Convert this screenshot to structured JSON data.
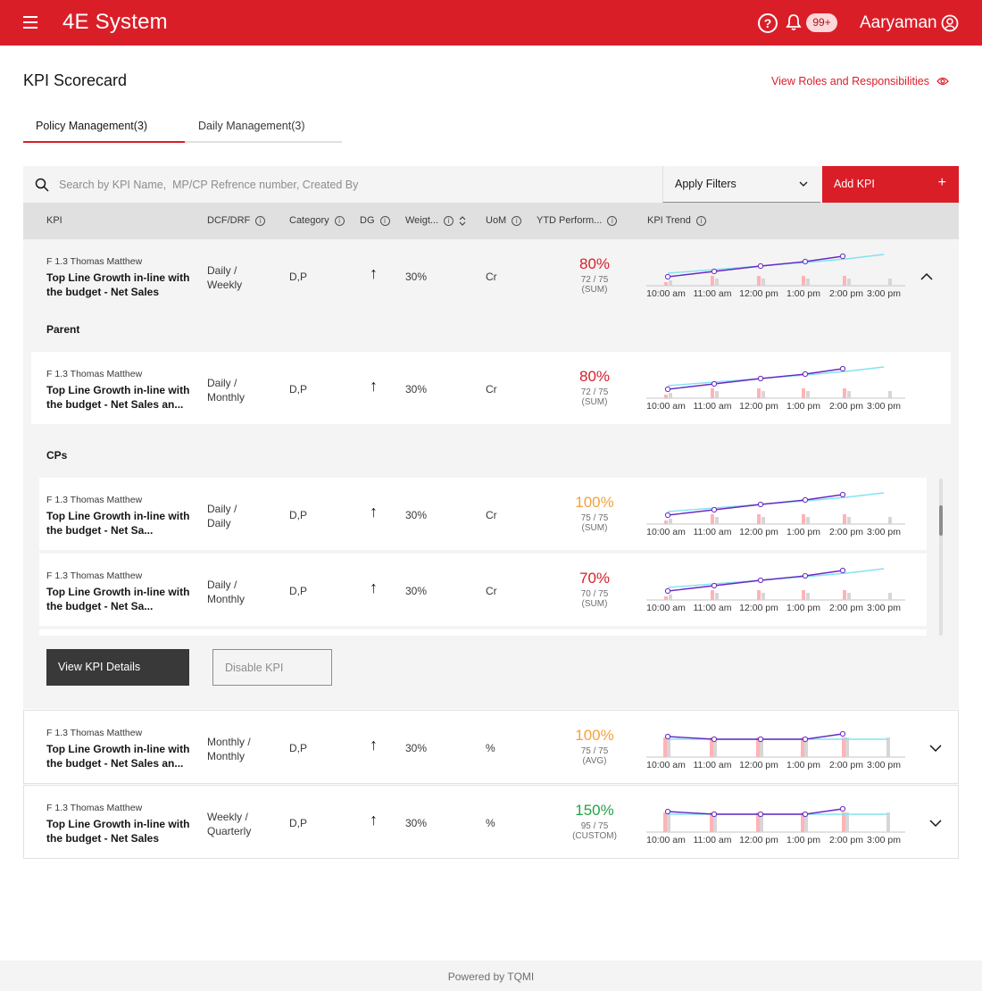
{
  "header": {
    "app_title": "4E System",
    "notification_count": "99+",
    "user_name": "Aaryaman",
    "brand_color": "#da1e28"
  },
  "page": {
    "title": "KPI Scorecard",
    "roles_link": "View Roles and Responsibilities"
  },
  "tabs": [
    {
      "label": "Policy Management(3)",
      "active": true
    },
    {
      "label": "Daily Management(3)",
      "active": false
    }
  ],
  "toolbar": {
    "search_placeholder": "Search by KPI Name,  MP/CP Refrence number, Created By",
    "filter_label": "Apply Filters",
    "add_label": "Add KPI",
    "add_icon": "+"
  },
  "columns": [
    "KPI",
    "DCF/DRF",
    "Category",
    "DG",
    "Weigt...",
    "UoM",
    "YTD Perform...",
    "KPI Trend"
  ],
  "sections": {
    "parent": "Parent",
    "cps": "CPs"
  },
  "trend_labels": [
    "10:00 am",
    "11:00 am",
    "12:00 pm",
    "1:00 pm",
    "2:00 pm",
    "3:00 pm"
  ],
  "rows": {
    "main": {
      "meta": "F 1.3   Thomas Matthew",
      "name": "Top Line Growth in-line with the budget - Net Sales",
      "dcf": "Daily /\nWeekly",
      "category": "D,P",
      "dg": "↑",
      "weight": "30%",
      "uom": "Cr",
      "ytd_pct": "80%",
      "ytd_frac": "72 / 75",
      "ytd_agg": "(SUM)",
      "ytd_color": "#da1e28"
    },
    "parent": {
      "meta": "F 1.3   Thomas Matthew",
      "name": "Top Line Growth in-line with the budget - Net Sales an...",
      "dcf": "Daily /\nMonthly",
      "category": "D,P",
      "dg": "↑",
      "weight": "30%",
      "uom": "Cr",
      "ytd_pct": "80%",
      "ytd_frac": "72 / 75",
      "ytd_agg": "(SUM)",
      "ytd_color": "#da1e28"
    },
    "cp1": {
      "meta": "F 1.3   Thomas Matthew",
      "name": "Top Line Growth in-line with the budget - Net Sa...",
      "dcf": "Daily /\nDaily",
      "category": "D,P",
      "dg": "↑",
      "weight": "30%",
      "uom": "Cr",
      "ytd_pct": "100%",
      "ytd_frac": "75 / 75",
      "ytd_agg": "(SUM)",
      "ytd_color": "#f1a33c"
    },
    "cp2": {
      "meta": "F 1.3   Thomas Matthew",
      "name": "Top Line Growth in-line with the budget - Net Sa...",
      "dcf": "Daily /\nMonthly",
      "category": "D,P",
      "dg": "↑",
      "weight": "30%",
      "uom": "Cr",
      "ytd_pct": "70%",
      "ytd_frac": "70 / 75",
      "ytd_agg": "(SUM)",
      "ytd_color": "#da1e28"
    },
    "row2": {
      "meta": "F 1.3   Thomas Matthew",
      "name": "Top Line Growth in-line with the budget - Net Sales an...",
      "dcf": "Monthly /\nMonthly",
      "category": "D,P",
      "dg": "↑",
      "weight": "30%",
      "uom": "%",
      "ytd_pct": "100%",
      "ytd_frac": "75 / 75",
      "ytd_agg": "(AVG)",
      "ytd_color": "#f1a33c"
    },
    "row3": {
      "meta": "F 1.3   Thomas Matthew",
      "name": "Top Line Growth in-line with the budget - Net Sales",
      "dcf": "Weekly /\nQuarterly",
      "category": "D,P",
      "dg": "↑",
      "weight": "30%",
      "uom": "%",
      "ytd_pct": "150%",
      "ytd_frac": "95 / 75",
      "ytd_agg": "(CUSTOM)",
      "ytd_color": "#24a148"
    }
  },
  "actions": {
    "view_details": "View KPI Details",
    "disable": "Disable KPI"
  },
  "footer": "Powered by TQMI"
}
